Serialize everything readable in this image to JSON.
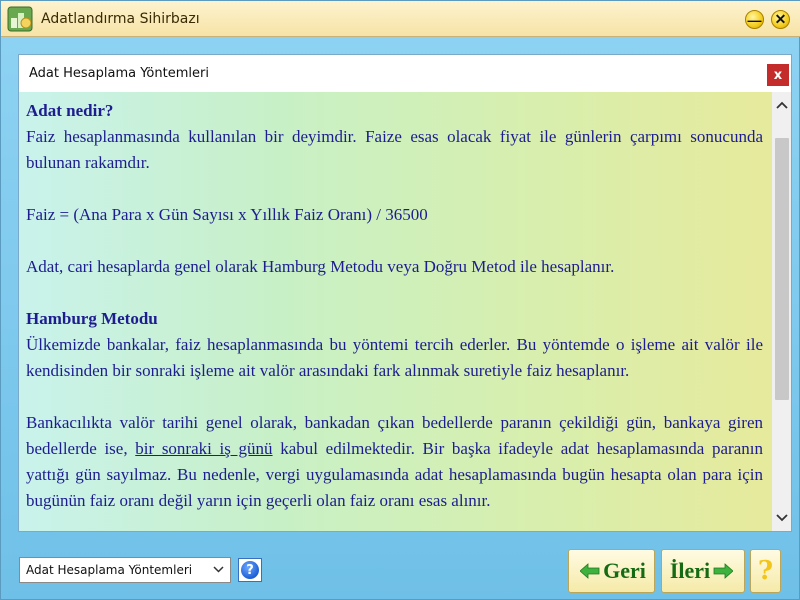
{
  "window": {
    "title": "Adatlandırma Sihirbazı",
    "minimize_glyph": "—",
    "close_glyph": "✕"
  },
  "dialog": {
    "title": "Adat Hesaplama Yöntemleri",
    "close_glyph": "x"
  },
  "content": {
    "h1": "Adat nedir?",
    "p1": "Faiz hesaplanmasında kullanılan bir deyimdir. Faize esas olacak fiyat ile günlerin çarpımı sonucunda bulunan rakamdır.",
    "formula": "Faiz = (Ana Para x Gün Sayısı x Yıllık Faiz Oranı) / 36500",
    "p2": "Adat, cari hesaplarda genel olarak Hamburg Metodu veya Doğru Metod ile hesaplanır.",
    "h2": "Hamburg Metodu",
    "p3": "Ülkemizde bankalar, faiz hesaplanmasında bu yöntemi tercih ederler. Bu yöntemde o işleme ait valör ile kendisinden bir sonraki işleme ait valör arasındaki fark alınmak suretiyle faiz hesaplanır.",
    "p4_a": "Bankacılıkta valör tarihi genel olarak, bankadan çıkan bedellerde paranın çekildiği gün, bankaya giren bedellerde ise, ",
    "p4_link": "bir sonraki iş günü",
    "p4_b": " kabul edilmektedir. Bir başka ifadeyle adat hesaplamasında paranın yattığı gün sayılmaz. Bu nedenle, vergi uygulamasında adat hesaplamasında bugün hesapta olan para için bugünün faiz oranı değil yarın için geçerli olan faiz oranı esas alınır."
  },
  "footer": {
    "select_value": "Adat Hesaplama Yöntemleri",
    "help_glyph": "?",
    "back_label": "Geri",
    "next_label": "İleri",
    "help_button_glyph": "?"
  },
  "icons": {
    "app": "app-icon",
    "minimize": "minimize-icon",
    "close": "close-icon",
    "scroll_up": "chevron-up-icon",
    "scroll_down": "chevron-down-icon",
    "back_arrow": "arrow-left-icon",
    "next_arrow": "arrow-right-icon",
    "help": "help-icon"
  },
  "colors": {
    "text": "#1d1d8f",
    "dialog_close": "#c42b2b",
    "nav_text": "#146b14",
    "arrow": "#3db23d"
  }
}
